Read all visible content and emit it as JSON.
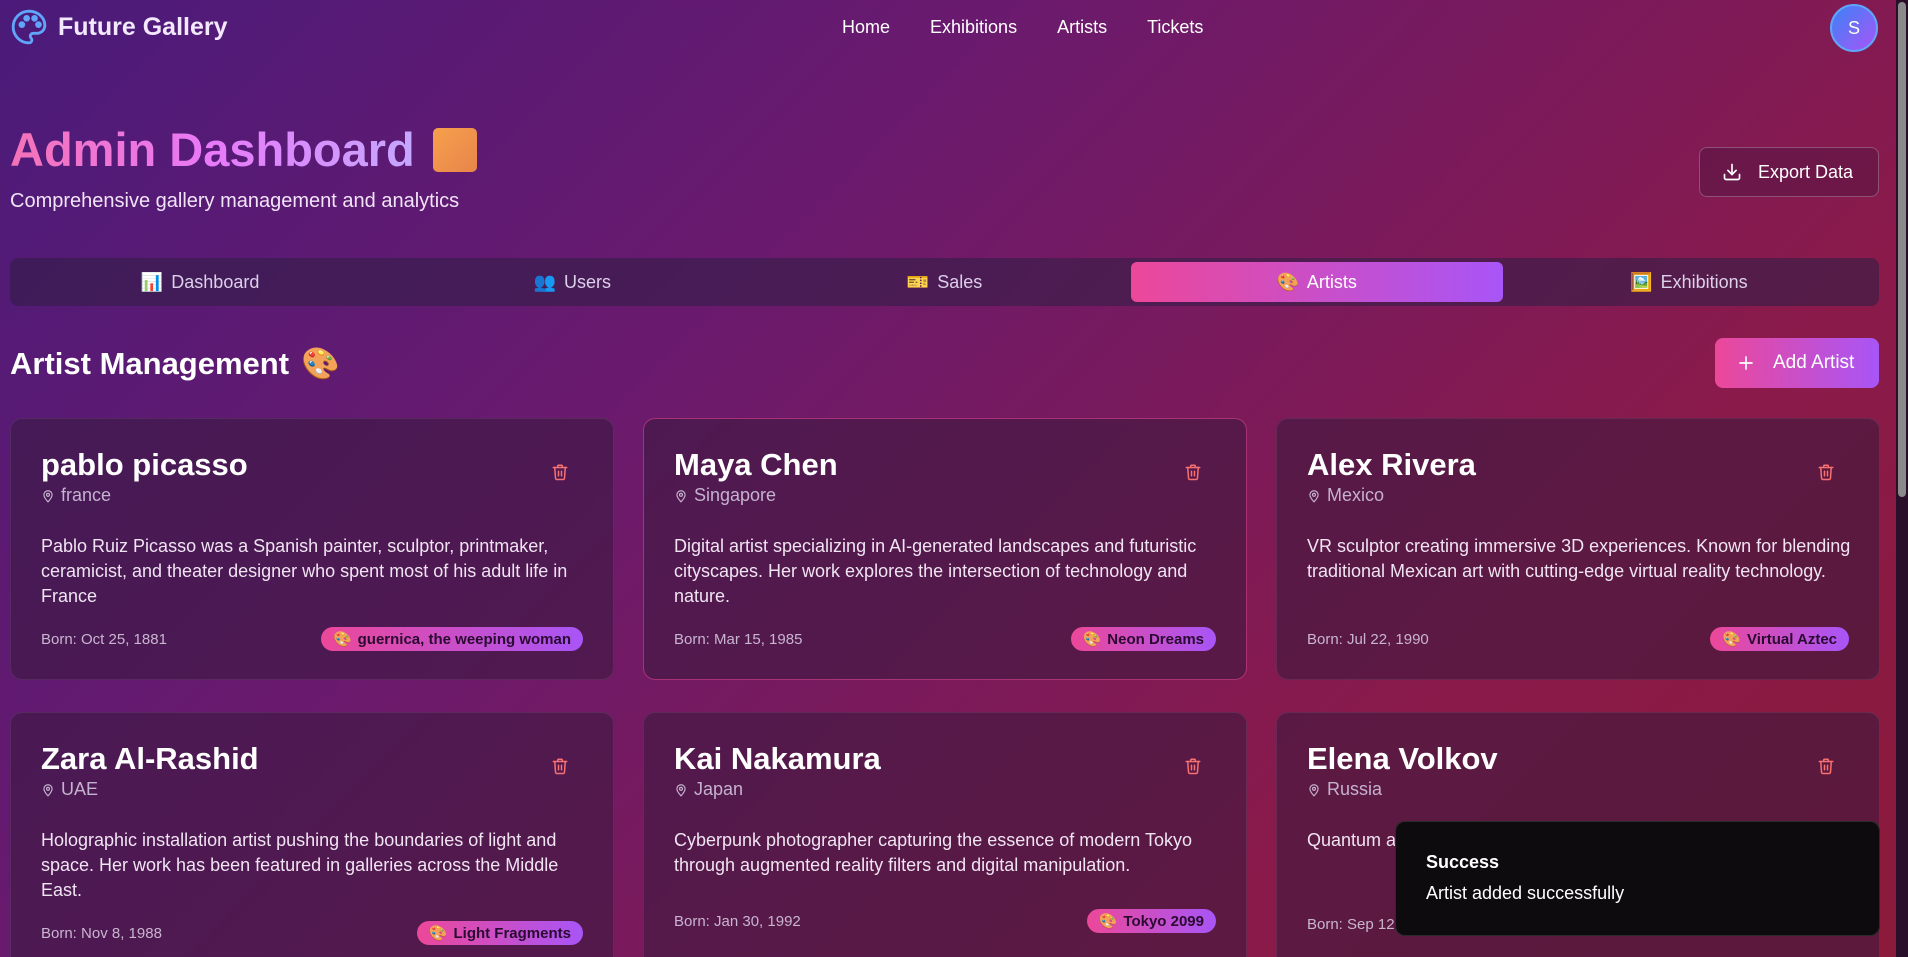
{
  "app": {
    "name": "Future Gallery"
  },
  "nav": {
    "items": [
      "Home",
      "Exhibitions",
      "Artists",
      "Tickets"
    ]
  },
  "user": {
    "initial": "S"
  },
  "page": {
    "title": "Admin Dashboard",
    "subtitle": "Comprehensive gallery management and analytics",
    "export_label": "Export Data"
  },
  "tabs": [
    {
      "label": "Dashboard",
      "icon": "📊"
    },
    {
      "label": "Users",
      "icon": "👥"
    },
    {
      "label": "Sales",
      "icon": "🎫"
    },
    {
      "label": "Artists",
      "icon": "🎨",
      "active": true
    },
    {
      "label": "Exhibitions",
      "icon": "🖼️"
    }
  ],
  "section": {
    "title": "Artist Management",
    "title_icon": "🎨",
    "add_label": "Add Artist"
  },
  "artists": [
    {
      "name": "pablo picasso",
      "location": "france",
      "description": "Pablo Ruiz Picasso was a Spanish painter, sculptor, printmaker, ceramicist, and theater designer who spent most of his adult life in France",
      "born": "Born: Oct 25, 1881",
      "work": "guernica, the weeping woman"
    },
    {
      "name": "Maya Chen",
      "location": "Singapore",
      "description": "Digital artist specializing in AI-generated landscapes and futuristic cityscapes. Her work explores the intersection of technology and nature.",
      "born": "Born: Mar 15, 1985",
      "work": "Neon Dreams"
    },
    {
      "name": "Alex Rivera",
      "location": "Mexico",
      "description": "VR sculptor creating immersive 3D experiences. Known for blending traditional Mexican art with cutting-edge virtual reality technology.",
      "born": "Born: Jul 22, 1990",
      "work": "Virtual Aztec"
    },
    {
      "name": "Zara Al-Rashid",
      "location": "UAE",
      "description": "Holographic installation artist pushing the boundaries of light and space. Her work has been featured in galleries across the Middle East.",
      "born": "Born: Nov 8, 1988",
      "work": "Light Fragments"
    },
    {
      "name": "Kai Nakamura",
      "location": "Japan",
      "description": "Cyberpunk photographer capturing the essence of modern Tokyo through augmented reality filters and digital manipulation.",
      "born": "Born: Jan 30, 1992",
      "work": "Tokyo 2099"
    },
    {
      "name": "Elena Volkov",
      "location": "Russia",
      "description": "Quantum a ever-chang",
      "born": "Born: Sep 12",
      "work": ""
    }
  ],
  "toast": {
    "title": "Success",
    "message": "Artist added successfully"
  },
  "colors": {
    "accent_pink": "#ec4899",
    "accent_purple": "#a855f7",
    "trash": "#f87171"
  }
}
